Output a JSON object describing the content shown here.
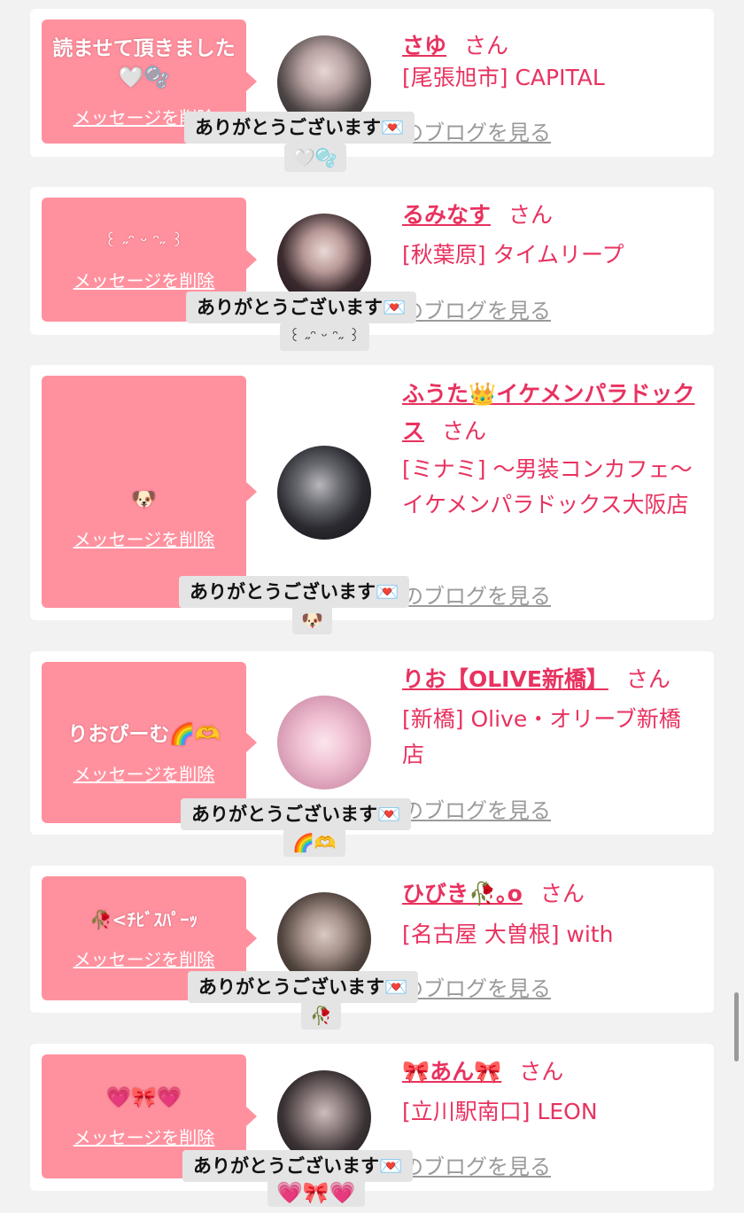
{
  "common": {
    "delete_label": "メッセージを削除",
    "san": "さん",
    "blog_label": "のブログを見る",
    "thanks_label": "ありがとうございます💌"
  },
  "cards": [
    {
      "bubble_message": "読ませて頂きました🤍🫧",
      "name": "さゆ",
      "shop": "[尾張旭市] CAPITAL",
      "reply_emoji": "🤍🫧"
    },
    {
      "bubble_message": "꒰ ˶ᵔ ᵕ ᵔ˶ ꒱",
      "name": "るみなす",
      "shop": "[秋葉原] タイムリープ",
      "reply_emoji": "꒰ ˶ᵔ ᵕ ᵔ˶ ꒱"
    },
    {
      "bubble_message": "🐶",
      "name": "ふうた👑イケメンパラドックス",
      "shop": "[ミナミ] 〜男装コンカフェ〜イケメンパラドックス大阪店",
      "reply_emoji": "🐶"
    },
    {
      "bubble_message": "りおぴーむ🌈🫶",
      "name": "りお【OLIVE新橋】",
      "shop": "[新橋] Olive・オリーブ新橋店",
      "reply_emoji": "🌈🫶"
    },
    {
      "bubble_message": "🥀<ﾁﾋﾞｽﾊﾟｰｯ",
      "name": "ひびき🥀｡o",
      "shop": "[名古屋 大曽根] with",
      "reply_emoji": "🥀"
    },
    {
      "bubble_message": "💗🎀💗",
      "name": "🎀あん🎀",
      "shop": "[立川駅南口] LEON",
      "reply_emoji": "💗🎀💗"
    }
  ],
  "colors": {
    "accent": "#e8325f",
    "bubble": "#ff919f",
    "page_bg": "#f2f2f2",
    "pill_bg": "#e4e4e4"
  }
}
